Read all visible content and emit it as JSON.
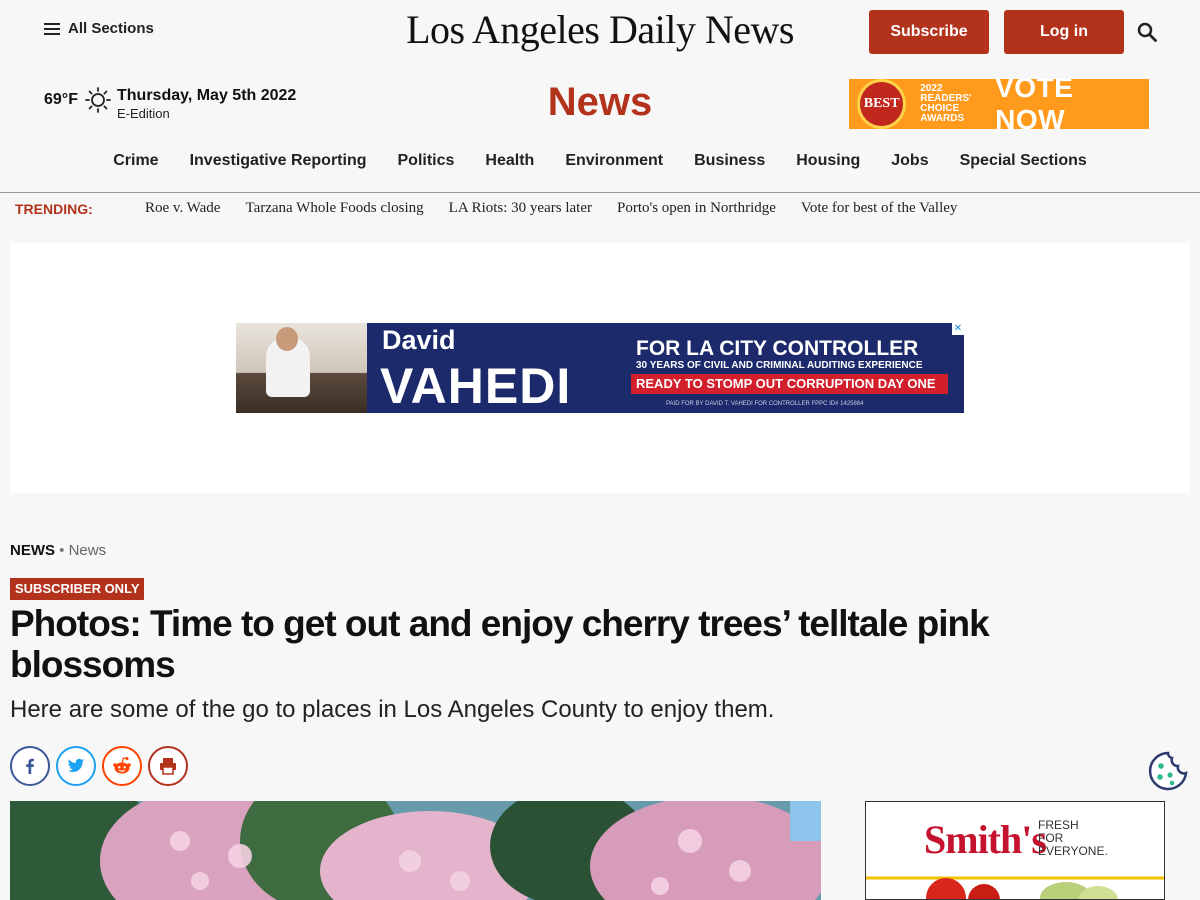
{
  "header": {
    "all_sections": "All Sections",
    "masthead": "Los Angeles Daily News",
    "subscribe": "Subscribe",
    "login": "Log in"
  },
  "weather": {
    "temp": "69°F",
    "icon": "sun-icon",
    "date": "Thursday, May 5th 2022",
    "edition": "E-Edition"
  },
  "section_title": "News",
  "nav": [
    "Crime",
    "Investigative Reporting",
    "Politics",
    "Health",
    "Environment",
    "Business",
    "Housing",
    "Jobs",
    "Special Sections"
  ],
  "trending": {
    "label": "TRENDING:",
    "items": [
      "Roe v. Wade",
      "Tarzana Whole Foods closing",
      "LA Riots: 30 years later",
      "Porto's open in Northridge",
      "Vote for best of the Valley"
    ]
  },
  "ads": {
    "vote": {
      "badge": "BEST",
      "small": "2022 READERS' CHOICE AWARDS",
      "big": "VOTE NOW"
    },
    "vahedi": {
      "first": "David",
      "last": "VAHEDI",
      "line1": "FOR LA CITY CONTROLLER",
      "line2": "30 YEARS OF CIVIL AND CRIMINAL AUDITING EXPERIENCE",
      "line3": "READY TO STOMP OUT CORRUPTION DAY ONE",
      "line4": "PAID FOR BY DAVID T. VAHEDI FOR CONTROLLER FPPC ID# 1425864",
      "close": "✕"
    },
    "smiths": {
      "logo": "Smith's",
      "tagline_1": "FRESH",
      "tagline_2": "FOR",
      "tagline_3": "EVERYONE."
    }
  },
  "article": {
    "breadcrumb_section": "NEWS",
    "breadcrumb_sep": " • ",
    "breadcrumb_sub": "News",
    "tag": "SUBSCRIBER ONLY",
    "headline": "Photos: Time to get out and enjoy cherry trees’ telltale pink blossoms",
    "dek": "Here are some of the go to places in Los Angeles County to enjoy them."
  },
  "share_icons": [
    "facebook-icon",
    "twitter-icon",
    "reddit-icon",
    "print-icon"
  ],
  "colors": {
    "brand_red": "#b3321b",
    "ad_navy": "#1c2a6b"
  }
}
